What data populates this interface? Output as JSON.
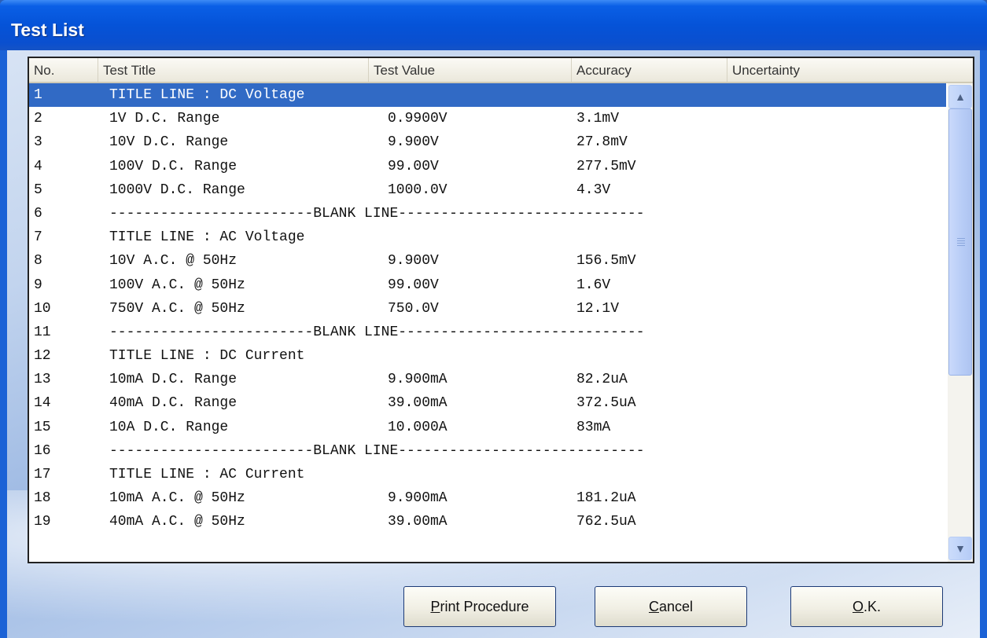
{
  "window": {
    "title": "Test List"
  },
  "columns": [
    "No.",
    "Test Title",
    "Test Value",
    "Accuracy",
    "Uncertainty"
  ],
  "blank_label": "------------------------BLANK LINE-----------------------------",
  "rows": [
    {
      "no": "1",
      "title": "TITLE LINE : DC Voltage",
      "value": "",
      "accuracy": "",
      "uncertainty": "",
      "selected": true
    },
    {
      "no": "2",
      "title": "1V D.C. Range",
      "value": "0.9900V",
      "accuracy": "3.1mV",
      "uncertainty": ""
    },
    {
      "no": "3",
      "title": "10V D.C. Range",
      "value": "9.900V",
      "accuracy": "27.8mV",
      "uncertainty": ""
    },
    {
      "no": "4",
      "title": "100V D.C. Range",
      "value": "99.00V",
      "accuracy": "277.5mV",
      "uncertainty": ""
    },
    {
      "no": "5",
      "title": "1000V D.C. Range",
      "value": "1000.0V",
      "accuracy": "4.3V",
      "uncertainty": ""
    },
    {
      "no": "6",
      "blank": true
    },
    {
      "no": "7",
      "title": "TITLE LINE : AC Voltage",
      "value": "",
      "accuracy": "",
      "uncertainty": ""
    },
    {
      "no": "8",
      "title": "10V A.C. @ 50Hz",
      "value": "9.900V",
      "accuracy": "156.5mV",
      "uncertainty": ""
    },
    {
      "no": "9",
      "title": "100V A.C. @ 50Hz",
      "value": "99.00V",
      "accuracy": "1.6V",
      "uncertainty": ""
    },
    {
      "no": "10",
      "title": "750V A.C. @ 50Hz",
      "value": "750.0V",
      "accuracy": "12.1V",
      "uncertainty": ""
    },
    {
      "no": "11",
      "blank": true
    },
    {
      "no": "12",
      "title": "TITLE LINE : DC Current",
      "value": "",
      "accuracy": "",
      "uncertainty": ""
    },
    {
      "no": "13",
      "title": "10mA D.C. Range",
      "value": "9.900mA",
      "accuracy": "82.2uA",
      "uncertainty": ""
    },
    {
      "no": "14",
      "title": "40mA D.C. Range",
      "value": "39.00mA",
      "accuracy": "372.5uA",
      "uncertainty": ""
    },
    {
      "no": "15",
      "title": "10A D.C. Range",
      "value": "10.000A",
      "accuracy": "83mA",
      "uncertainty": ""
    },
    {
      "no": "16",
      "blank": true
    },
    {
      "no": "17",
      "title": "TITLE LINE : AC Current",
      "value": "",
      "accuracy": "",
      "uncertainty": ""
    },
    {
      "no": "18",
      "title": "10mA A.C. @ 50Hz",
      "value": "9.900mA",
      "accuracy": "181.2uA",
      "uncertainty": ""
    },
    {
      "no": "19",
      "title": "40mA A.C. @ 50Hz",
      "value": "39.00mA",
      "accuracy": "762.5uA",
      "uncertainty": ""
    }
  ],
  "scrollbar": {
    "up_icon": "chevron-up-icon",
    "down_icon": "chevron-down-icon"
  },
  "buttons": {
    "print": {
      "accel": "P",
      "rest": "rint Procedure"
    },
    "cancel": {
      "accel": "C",
      "rest": "ancel"
    },
    "ok": {
      "accel": "O",
      "rest": ".K."
    }
  }
}
